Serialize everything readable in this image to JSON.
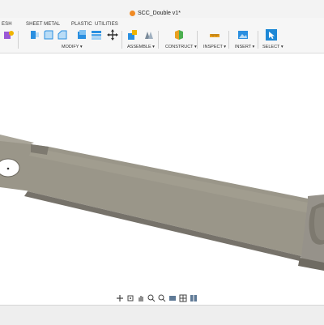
{
  "title": {
    "document": "SCC_Double v1*"
  },
  "tabs": [
    "ESH",
    "SHEET METAL",
    "PLASTIC",
    "UTILITIES"
  ],
  "groups": {
    "modify": "MODIFY ▾",
    "assemble": "ASSEMBLE ▾",
    "construct": "CONSTRUCT ▾",
    "inspect": "INSPECT ▾",
    "insert": "INSERT ▾",
    "select": "SELECT ▾"
  },
  "icons": {
    "tools": [
      "mesh-tool-icon",
      "press-pull-icon",
      "fillet-icon",
      "chamfer-icon",
      "shell-icon",
      "combine-icon",
      "move-icon",
      "new-component-icon",
      "joint-icon",
      "offset-plane-icon",
      "measure-icon",
      "insert-image-icon",
      "select-icon"
    ],
    "nav": [
      "orbit-icon",
      "look-at-icon",
      "pan-icon",
      "zoom-icon",
      "fit-icon",
      "display-settings-icon",
      "grid-settings-icon",
      "viewports-icon"
    ]
  },
  "colors": {
    "accent": "#1e88d6",
    "model_face": "#9a9689",
    "model_side": "#6f6b62",
    "model_top": "#b8b4a8"
  }
}
